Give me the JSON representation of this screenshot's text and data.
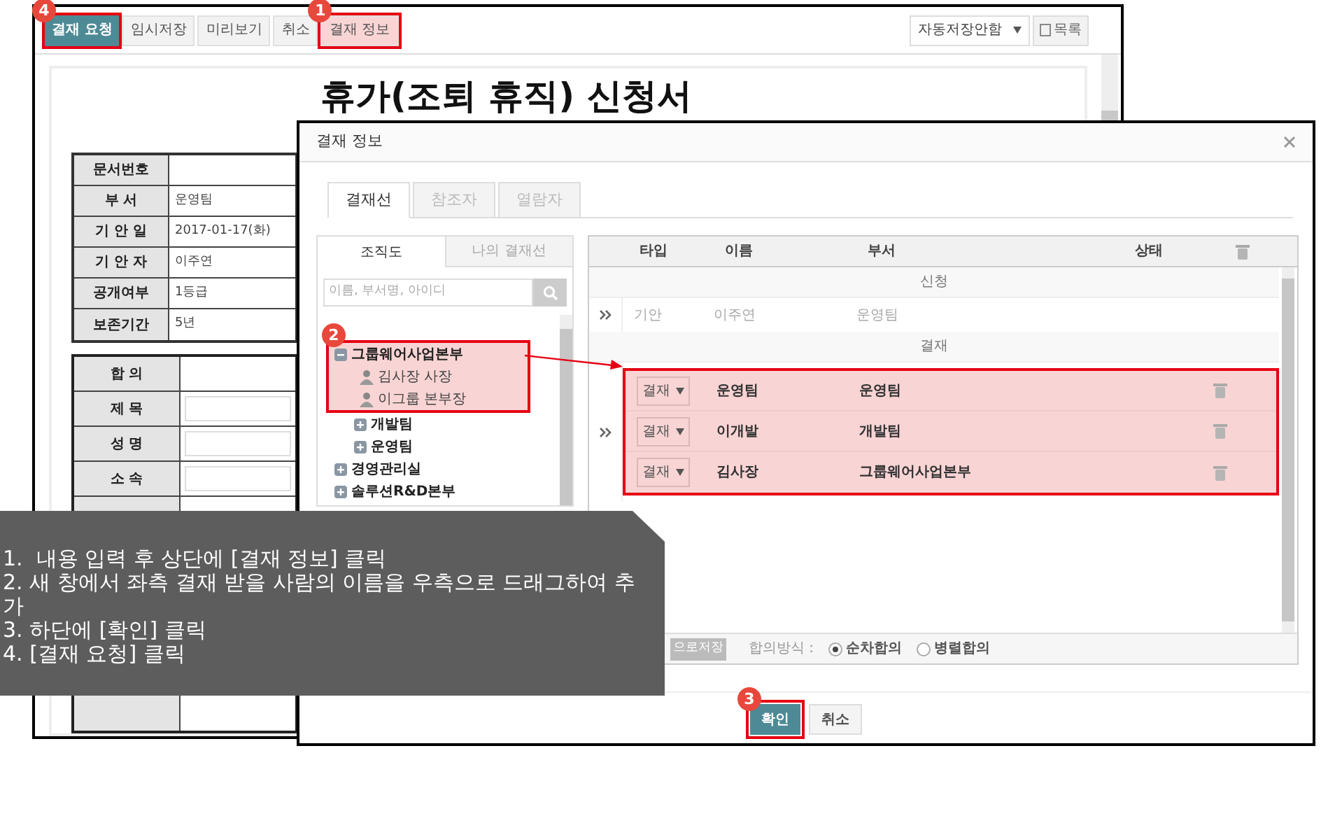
{
  "main_window": {
    "toolbar": [
      {
        "label": "결재 요청",
        "kind": "primary",
        "step": "4"
      },
      {
        "label": "임시저장",
        "kind": "default"
      },
      {
        "label": "미리보기",
        "kind": "default"
      },
      {
        "label": "취소",
        "kind": "default"
      },
      {
        "label": "결재 정보",
        "kind": "default",
        "step": "1"
      }
    ],
    "autosave_select": "자동저장안함",
    "list_button": "목록",
    "document": {
      "title": "휴가(조퇴 휴직) 신청서",
      "info_table": [
        {
          "label": "문서번호"
        },
        {
          "label": "부 서",
          "value": "운영팀"
        },
        {
          "label": "기 안 일",
          "value": "2017-01-17(화)"
        },
        {
          "label": "기 안 자",
          "value": "이주연"
        },
        {
          "label": "공개여부",
          "value": "1등급"
        },
        {
          "label": "보존기간",
          "value": "5년"
        }
      ],
      "form_table": [
        {
          "label": "합 의",
          "kind": "text"
        },
        {
          "label": "제 목",
          "kind": "input"
        },
        {
          "label": "성 명",
          "kind": "input"
        },
        {
          "label": "소 속",
          "kind": "input"
        }
      ]
    }
  },
  "dialog": {
    "title": "결재 정보",
    "tabs": [
      {
        "label": "결재선",
        "selected": true
      },
      {
        "label": "참조자",
        "selected": false
      },
      {
        "label": "열람자",
        "selected": false
      }
    ],
    "left_panel": {
      "tabs": [
        {
          "label": "조직도",
          "selected": true
        },
        {
          "label": "나의 결재선",
          "selected": false
        }
      ],
      "search": {
        "placeholder": "이름, 부서명, 아이디"
      },
      "tree": [
        {
          "label": "그룹웨어사업본부",
          "kind": "group",
          "expanded": true,
          "step": "2",
          "children": [
            {
              "label": "김사장 사장",
              "kind": "person",
              "highlighted": true
            },
            {
              "label": "이그룹 본부장",
              "kind": "person",
              "highlighted": true
            },
            {
              "label": "개발팀",
              "kind": "group",
              "expanded": false
            },
            {
              "label": "운영팀",
              "kind": "group",
              "expanded": false
            }
          ]
        },
        {
          "label": "경영관리실",
          "kind": "group",
          "expanded": false
        },
        {
          "label": "솔루션R&D본부",
          "kind": "group",
          "expanded": false
        }
      ]
    },
    "right_panel": {
      "columns": [
        "타입",
        "이름",
        "부서",
        "상태"
      ],
      "sections": [
        {
          "label": "신청",
          "highlighted": false,
          "rows": [
            {
              "kind": "fixed",
              "type": "기안",
              "name": "이주연",
              "dept": "운영팀"
            }
          ]
        },
        {
          "label": "결재",
          "highlighted": true,
          "rows": [
            {
              "kind": "editable",
              "type": "결재",
              "name": "운영팀",
              "dept": "운영팀"
            },
            {
              "kind": "editable",
              "type": "결재",
              "name": "이개발",
              "dept": "개발팀"
            },
            {
              "kind": "editable",
              "type": "결재",
              "name": "김사장",
              "dept": "그룹웨어사업본부"
            }
          ]
        }
      ],
      "save_button": "으로저장",
      "agreement": {
        "label": "합의방식 :",
        "options": [
          {
            "label": "순차합의",
            "selected": true
          },
          {
            "label": "병렬합의",
            "selected": false
          }
        ]
      }
    },
    "buttons": [
      {
        "label": "확인",
        "kind": "primary",
        "step": "3"
      },
      {
        "label": "취소",
        "kind": "default"
      }
    ]
  },
  "callout": {
    "lines": [
      "1.  내용 입력 후 상단에 [결재 정보] 클릭",
      "2. 새 창에서 좌측 결재 받을 사람의 이름을 우측으로 드래그하여 추가",
      "3. 하단에 [확인] 클릭",
      "4. [결재 요청] 클릭"
    ]
  }
}
